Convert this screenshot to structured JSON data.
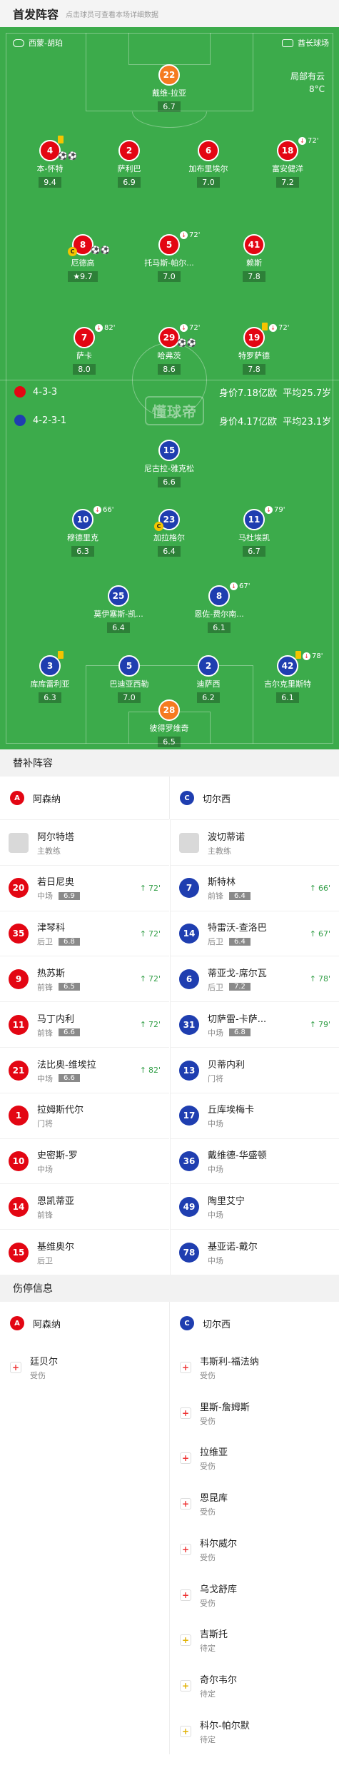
{
  "header": {
    "title": "首发阵容",
    "hint": "点击球员可查看本场详细数据"
  },
  "pitch": {
    "referee": "西蒙-胡珀",
    "stadium": "酋长球场",
    "weather": {
      "desc": "局部有云",
      "temp": "8°C"
    },
    "logo": "懂球帝",
    "home_formation": {
      "formation": "4-3-3",
      "value": "身价7.18亿欧",
      "age": "平均25.7岁"
    },
    "away_formation": {
      "formation": "4-2-3-1",
      "value": "身价4.17亿欧",
      "age": "平均23.1岁"
    }
  },
  "colors": {
    "home": "#e30613",
    "away": "#1f3eb0",
    "gk": "#f57a20",
    "sub_time": "#35a04a"
  },
  "home_players": [
    {
      "num": "22",
      "name": "戴维-拉亚",
      "rating": "6.7",
      "gk": true
    },
    {
      "num": "4",
      "name": "本-怀特",
      "rating": "9.4",
      "card": "yellow",
      "balls": "⚽⚽"
    },
    {
      "num": "2",
      "name": "萨利巴",
      "rating": "6.9"
    },
    {
      "num": "6",
      "name": "加布里埃尔",
      "rating": "7.0"
    },
    {
      "num": "18",
      "name": "富安健洋",
      "rating": "7.2",
      "event": "72'"
    },
    {
      "num": "8",
      "name": "厄德高",
      "rating": "9.7",
      "captain": "C",
      "balls": "⚽⚽"
    },
    {
      "num": "5",
      "name": "托马斯-帕尔...",
      "rating": "7.0",
      "event": "72'"
    },
    {
      "num": "41",
      "name": "赖斯",
      "rating": "7.8"
    },
    {
      "num": "7",
      "name": "萨卡",
      "rating": "8.0",
      "event": "82'"
    },
    {
      "num": "29",
      "name": "哈弗茨",
      "rating": "8.6",
      "event": "72'",
      "balls": "⚽⚽"
    },
    {
      "num": "19",
      "name": "特罗萨德",
      "rating": "7.8",
      "event": "72'",
      "card": "yellow"
    }
  ],
  "away_players": [
    {
      "num": "15",
      "name": "尼古拉-雅克松",
      "rating": "6.6"
    },
    {
      "num": "10",
      "name": "穆德里克",
      "rating": "6.3",
      "event": "66'"
    },
    {
      "num": "23",
      "name": "加拉格尔",
      "rating": "6.4",
      "captain": "C"
    },
    {
      "num": "11",
      "name": "马杜埃凯",
      "rating": "6.7",
      "event": "79'"
    },
    {
      "num": "25",
      "name": "莫伊塞斯-凯...",
      "rating": "6.4"
    },
    {
      "num": "8",
      "name": "恩佐-费尔南...",
      "rating": "6.1",
      "event": "67'"
    },
    {
      "num": "3",
      "name": "库库雷利亚",
      "rating": "6.3",
      "card": "yellow"
    },
    {
      "num": "5",
      "name": "巴迪亚西勒",
      "rating": "7.0"
    },
    {
      "num": "2",
      "name": "迪萨西",
      "rating": "6.2"
    },
    {
      "num": "42",
      "name": "吉尔克里斯特",
      "rating": "6.1",
      "event": "78'",
      "card": "yellow"
    },
    {
      "num": "28",
      "name": "彼得罗维奇",
      "rating": "6.5",
      "gk": true
    }
  ],
  "subs": {
    "title": "替补阵容",
    "home_team": "阿森纳",
    "away_team": "切尔西",
    "home": [
      {
        "num": "",
        "name": "阿尔特塔",
        "pos": "主教练",
        "coach": true
      },
      {
        "num": "20",
        "name": "若日尼奥",
        "pos": "中场",
        "rating": "6.9",
        "time": "72'"
      },
      {
        "num": "35",
        "name": "津琴科",
        "pos": "后卫",
        "rating": "6.8",
        "time": "72'"
      },
      {
        "num": "9",
        "name": "热苏斯",
        "pos": "前锋",
        "rating": "6.5",
        "time": "72'"
      },
      {
        "num": "11",
        "name": "马丁内利",
        "pos": "前锋",
        "rating": "6.6",
        "time": "72'"
      },
      {
        "num": "21",
        "name": "法比奥-维埃拉",
        "pos": "中场",
        "rating": "6.6",
        "time": "82'"
      },
      {
        "num": "1",
        "name": "拉姆斯代尔",
        "pos": "门将"
      },
      {
        "num": "10",
        "name": "史密斯-罗",
        "pos": "中场"
      },
      {
        "num": "14",
        "name": "恩凯蒂亚",
        "pos": "前锋"
      },
      {
        "num": "15",
        "name": "基维奥尔",
        "pos": "后卫"
      }
    ],
    "away": [
      {
        "num": "",
        "name": "波切蒂诺",
        "pos": "主教练",
        "coach": true
      },
      {
        "num": "7",
        "name": "斯特林",
        "pos": "前锋",
        "rating": "6.4",
        "time": "66'"
      },
      {
        "num": "14",
        "name": "特雷沃-查洛巴",
        "pos": "后卫",
        "rating": "6.4",
        "time": "67'"
      },
      {
        "num": "6",
        "name": "蒂亚戈-席尔瓦",
        "pos": "后卫",
        "rating": "7.2",
        "time": "78'"
      },
      {
        "num": "31",
        "name": "切萨雷-卡萨...",
        "pos": "中场",
        "rating": "6.8",
        "time": "79'"
      },
      {
        "num": "13",
        "name": "贝蒂内利",
        "pos": "门将"
      },
      {
        "num": "17",
        "name": "丘库埃梅卡",
        "pos": "中场"
      },
      {
        "num": "36",
        "name": "戴维德-华盛顿",
        "pos": "中场"
      },
      {
        "num": "49",
        "name": "陶里艾宁",
        "pos": "中场"
      },
      {
        "num": "78",
        "name": "基亚诺-戴尔",
        "pos": "中场"
      }
    ]
  },
  "injuries": {
    "title": "伤停信息",
    "home_team": "阿森纳",
    "away_team": "切尔西",
    "home": [
      {
        "name": "廷贝尔",
        "status": "受伤",
        "type": "injury"
      }
    ],
    "away": [
      {
        "name": "韦斯利-福法纳",
        "status": "受伤",
        "type": "injury"
      },
      {
        "name": "里斯-詹姆斯",
        "status": "受伤",
        "type": "injury"
      },
      {
        "name": "拉维亚",
        "status": "受伤",
        "type": "injury"
      },
      {
        "name": "恩昆库",
        "status": "受伤",
        "type": "injury"
      },
      {
        "name": "科尔威尔",
        "status": "受伤",
        "type": "injury"
      },
      {
        "name": "乌戈舒库",
        "status": "受伤",
        "type": "injury"
      },
      {
        "name": "吉斯托",
        "status": "待定",
        "type": "doubt"
      },
      {
        "name": "奇尔韦尔",
        "status": "待定",
        "type": "doubt"
      },
      {
        "name": "科尔-帕尔默",
        "status": "待定",
        "type": "doubt"
      }
    ]
  }
}
